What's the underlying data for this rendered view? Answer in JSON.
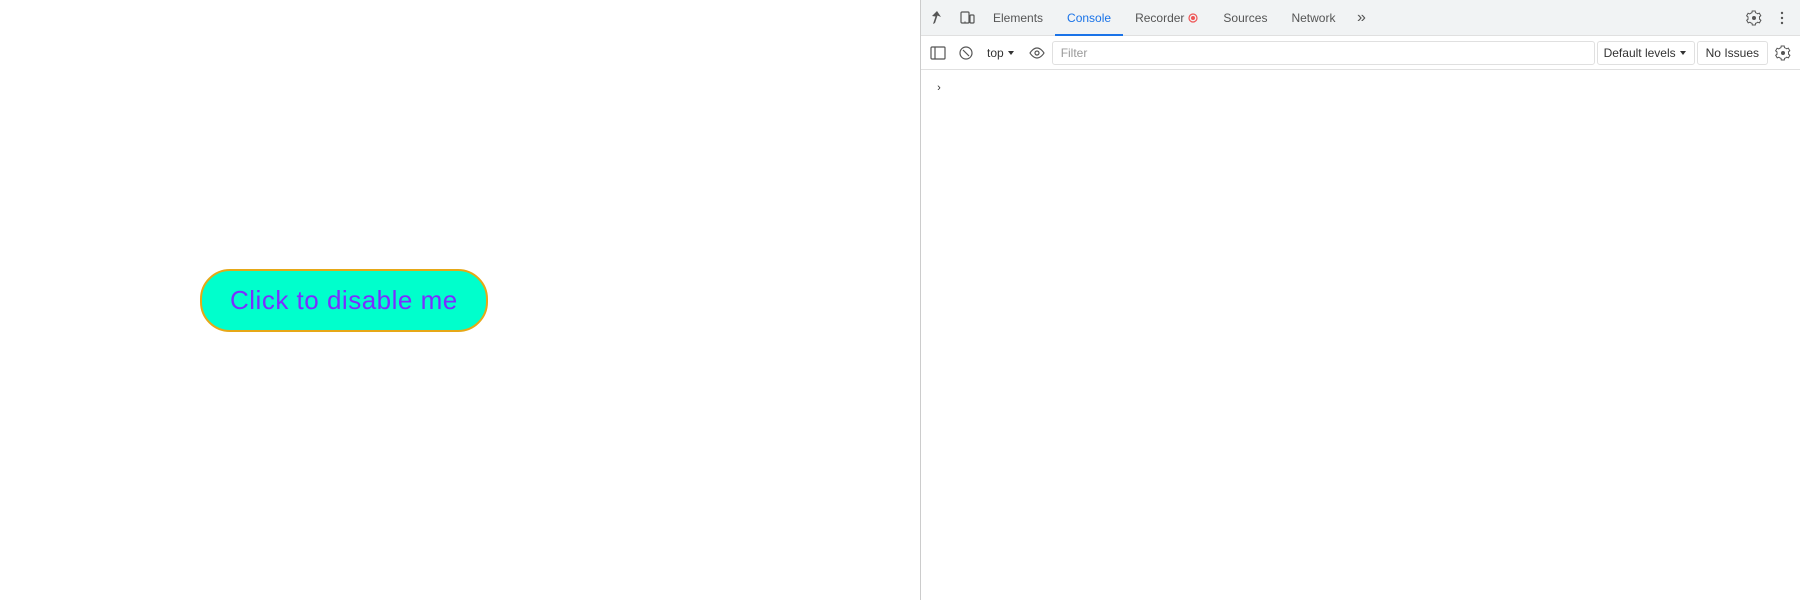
{
  "webpage": {
    "button_label": "Click to disable me"
  },
  "devtools": {
    "tabs": [
      {
        "id": "elements",
        "label": "Elements",
        "active": false
      },
      {
        "id": "console",
        "label": "Console",
        "active": true
      },
      {
        "id": "recorder",
        "label": "Recorder",
        "active": false
      },
      {
        "id": "sources",
        "label": "Sources",
        "active": false
      },
      {
        "id": "network",
        "label": "Network",
        "active": false
      }
    ],
    "console_bar": {
      "top_context": "top",
      "filter_placeholder": "Filter",
      "default_levels_label": "Default levels",
      "no_issues_label": "No Issues"
    }
  }
}
